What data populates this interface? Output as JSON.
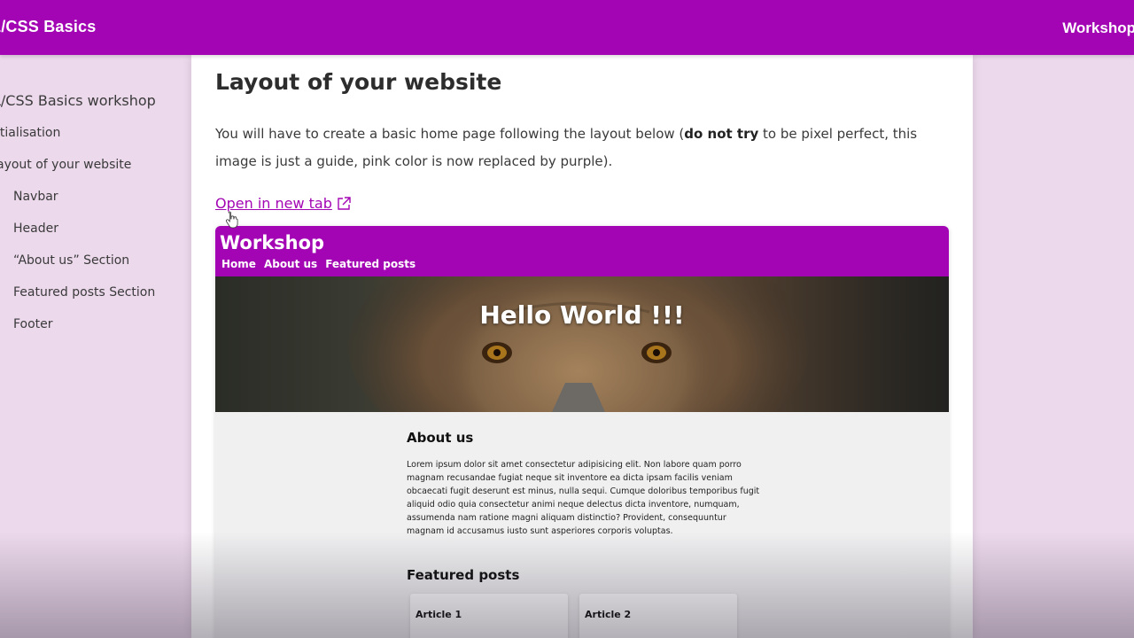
{
  "topbar": {
    "brand": "L/CSS Basics",
    "right_label": "Workshop"
  },
  "sidebar": {
    "title": "L/CSS Basics workshop",
    "items": [
      {
        "label": "itialisation"
      },
      {
        "label": "ayout of your website"
      },
      {
        "label": "Navbar"
      },
      {
        "label": "Header"
      },
      {
        "label": "“About us” Section"
      },
      {
        "label": "Featured posts Section"
      },
      {
        "label": "Footer"
      }
    ]
  },
  "main": {
    "title": "Layout of your website",
    "intro_part1": "You will have to create a basic home page following the layout below (",
    "intro_bold": "do not try",
    "intro_part2": " to be pixel perfect, this image is just a guide, pink color is now replaced by purple).",
    "open_link": "Open in new tab"
  },
  "preview": {
    "brand": "Workshop",
    "nav_links": [
      "Home",
      "About us",
      "Featured posts"
    ],
    "hero_title": "Hello World !!!",
    "about_title": "About us",
    "about_text": "Lorem ipsum dolor sit amet consectetur adipisicing elit. Non labore quam porro magnam recusandae fugiat neque sit inventore ea dicta ipsam facilis veniam obcaecati fugit deserunt est minus, nulla sequi. Cumque doloribus temporibus fugit aliquid odio quia consectetur animi neque delectus dicta inventore, numquam, assumenda nam ratione magni aliquam distinctio? Provident, consequuntur magnam id accusamus iusto sunt asperiores corporis voluptas.",
    "featured_title": "Featured posts",
    "cards": [
      {
        "label": "Article 1"
      },
      {
        "label": "Article 2"
      }
    ]
  },
  "colors": {
    "accent": "#a305b4",
    "sidebar_bg": "#ecd9ec",
    "content_bg": "#ffffff",
    "preview_bg": "#f0f0f1"
  },
  "icons": {
    "external_link": "external-link-icon",
    "cursor": "hand-cursor-icon"
  }
}
